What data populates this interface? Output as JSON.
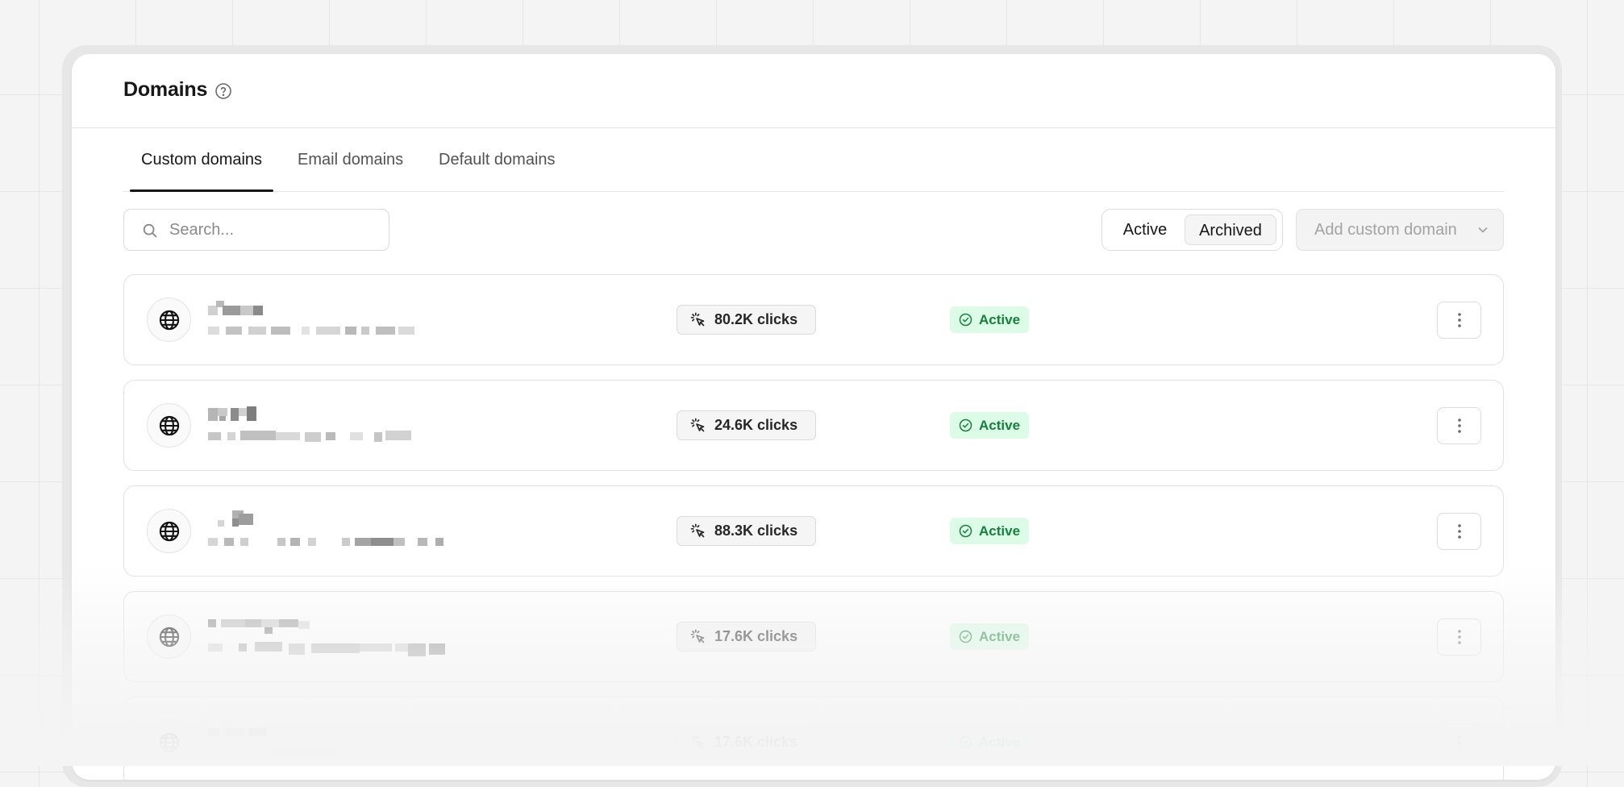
{
  "header": {
    "title": "Domains",
    "help_icon": "question-circle-icon"
  },
  "tabs": [
    {
      "label": "Custom domains",
      "active": true
    },
    {
      "label": "Email domains",
      "active": false
    },
    {
      "label": "Default domains",
      "active": false
    }
  ],
  "search": {
    "placeholder": "Search...",
    "value": "",
    "icon": "search-icon"
  },
  "filter_toggle": {
    "options": [
      "Active",
      "Archived"
    ],
    "selected": "Archived"
  },
  "add_button": {
    "label": "Add custom domain",
    "icon": "chevron-down-icon",
    "disabled": true
  },
  "domains": [
    {
      "clicks": "80.2K clicks",
      "status": "Active"
    },
    {
      "clicks": "24.6K clicks",
      "status": "Active"
    },
    {
      "clicks": "88.3K clicks",
      "status": "Active"
    },
    {
      "clicks": "17.6K clicks",
      "status": "Active"
    },
    {
      "clicks": "17.6K clicks",
      "status": "Active"
    }
  ],
  "colors": {
    "status_bg": "#dcfce7",
    "status_text": "#15803d",
    "accent_underline": "#171717"
  }
}
